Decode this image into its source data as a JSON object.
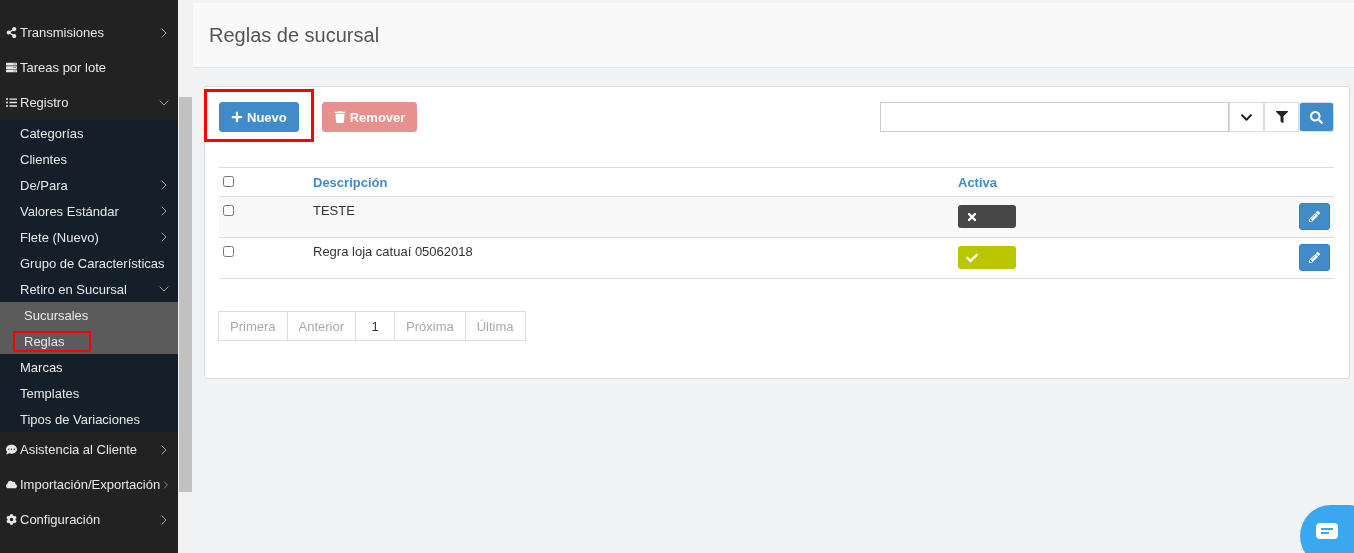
{
  "sidebar": {
    "items": [
      {
        "label": "Transmisiones",
        "expanded": false
      },
      {
        "label": "Tareas por lote"
      },
      {
        "label": "Registro",
        "expanded": true,
        "children": [
          {
            "label": "Categorías"
          },
          {
            "label": "Clientes"
          },
          {
            "label": "De/Para",
            "expanded": false
          },
          {
            "label": "Valores Estándar",
            "expanded": false
          },
          {
            "label": "Flete (Nuevo)",
            "expanded": false
          },
          {
            "label": "Grupo de Características"
          },
          {
            "label": "Retiro en Sucursal",
            "expanded": true,
            "children": [
              {
                "label": "Sucursales",
                "highlighted": false
              },
              {
                "label": "Reglas",
                "highlighted": true
              }
            ]
          },
          {
            "label": "Marcas"
          },
          {
            "label": "Templates"
          },
          {
            "label": "Tipos de Variaciones"
          }
        ]
      },
      {
        "label": "Asistencia al Cliente",
        "expanded": false
      },
      {
        "label": "Importación/Exportación",
        "expanded": false
      },
      {
        "label": "Configuración",
        "expanded": false
      }
    ]
  },
  "page": {
    "title": "Reglas de sucursal"
  },
  "toolbar": {
    "buttons": [
      {
        "label": "Nuevo",
        "kind": "new",
        "highlighted": true
      },
      {
        "label": "Remover",
        "kind": "remove",
        "highlighted": false
      }
    ]
  },
  "table": {
    "header_checked": false,
    "columns": [
      "Descripción",
      "Activa"
    ],
    "rows": [
      {
        "description": "TESTE",
        "active": false,
        "checked": false
      },
      {
        "description": "Regra loja catuaí 05062018",
        "active": true,
        "checked": false
      }
    ]
  },
  "pagination": [
    {
      "label": "Primera",
      "selected": false
    },
    {
      "label": "Anterior",
      "selected": false
    },
    {
      "label": "1",
      "selected": true
    },
    {
      "label": "Próxima",
      "selected": false
    },
    {
      "label": "Última",
      "selected": false
    }
  ]
}
